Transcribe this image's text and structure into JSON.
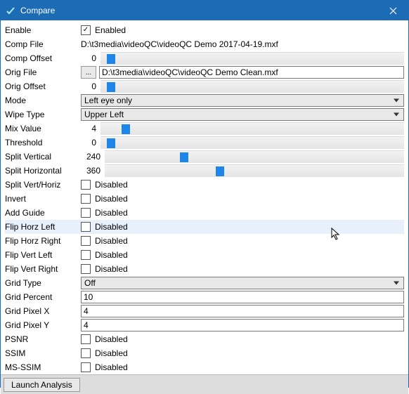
{
  "window": {
    "title": "Compare"
  },
  "rows": {
    "enable": {
      "label": "Enable",
      "checked": true,
      "text": "Enabled"
    },
    "compFile": {
      "label": "Comp File",
      "value": "D:\\t3media\\videoQC\\videoQC Demo 2017-04-19.mxf"
    },
    "compOffset": {
      "label": "Comp Offset",
      "value": "0",
      "thumbPct": 2
    },
    "origFile": {
      "label": "Orig File",
      "browse": "...",
      "value": "D:\\t3media\\videoQC\\videoQC Demo Clean.mxf"
    },
    "origOffset": {
      "label": "Orig Offset",
      "value": "0",
      "thumbPct": 2
    },
    "mode": {
      "label": "Mode",
      "value": "Left eye only"
    },
    "wipeType": {
      "label": "Wipe Type",
      "value": "Upper Left"
    },
    "mixValue": {
      "label": "Mix Value",
      "value": "4",
      "thumbPct": 7
    },
    "threshold": {
      "label": "Threshold",
      "value": "0",
      "thumbPct": 2
    },
    "splitVert": {
      "label": "Split Vertical",
      "value": "240",
      "thumbPct": 25
    },
    "splitHorz": {
      "label": "Split Horizontal",
      "value": "360",
      "thumbPct": 37
    },
    "splitVH": {
      "label": "Split Vert/Horiz",
      "checked": false,
      "text": "Disabled"
    },
    "invert": {
      "label": "Invert",
      "checked": false,
      "text": "Disabled"
    },
    "addGuide": {
      "label": "Add Guide",
      "checked": false,
      "text": "Disabled"
    },
    "flipHL": {
      "label": "Flip Horz Left",
      "checked": false,
      "text": "Disabled"
    },
    "flipHR": {
      "label": "Flip Horz Right",
      "checked": false,
      "text": "Disabled"
    },
    "flipVL": {
      "label": "Flip Vert Left",
      "checked": false,
      "text": "Disabled"
    },
    "flipVR": {
      "label": "Flip Vert Right",
      "checked": false,
      "text": "Disabled"
    },
    "gridType": {
      "label": "Grid Type",
      "value": "Off"
    },
    "gridPercent": {
      "label": "Grid Percent",
      "value": "10"
    },
    "gridPixelX": {
      "label": "Grid Pixel X",
      "value": "4"
    },
    "gridPixelY": {
      "label": "Grid Pixel Y",
      "value": "4"
    },
    "psnr": {
      "label": "PSNR",
      "checked": false,
      "text": "Disabled"
    },
    "ssim": {
      "label": "SSIM",
      "checked": false,
      "text": "Disabled"
    },
    "msssim": {
      "label": "MS-SSIM",
      "checked": false,
      "text": "Disabled"
    }
  },
  "footer": {
    "launch": "Launch Analysis"
  }
}
